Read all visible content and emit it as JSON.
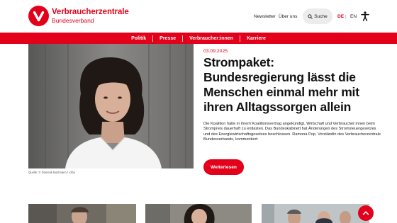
{
  "brand": {
    "title": "Verbraucherzentrale",
    "subtitle": "Bundesverband"
  },
  "utility_nav": {
    "newsletter": "Newsletter",
    "about": "Über uns",
    "search": "Suche",
    "lang_de": "DE",
    "lang_separator": "|",
    "lang_en": "EN"
  },
  "main_nav": [
    {
      "label": "Politik"
    },
    {
      "label": "Presse"
    },
    {
      "label": "Verbraucher:innen"
    },
    {
      "label": "Karriere"
    }
  ],
  "article": {
    "date": "03.09.2025",
    "headline": "Strompaket: Bundesregierung lässt die Menschen einmal mehr mit ihren Alltagssorgen allein",
    "teaser": "Die Koalition hatte in ihrem Koalitionsvertrag angekündigt, Wirtschaft und Verbraucher:innen beim Strompreis dauerhaft zu entlasten. Das Bundeskabinett hat Änderungen des Stromsteuergesetzes und des Energiewirtschaftsgesetzes beschlossen. Ramona Pop, Vorständin des Verbraucherzentrale Bundesverbands, kommentiert:",
    "read_more": "Weiterlesen",
    "image_caption": "Quelle: © Dominik Butzmann / vzbv"
  },
  "icons": {
    "logo": "verbraucherzentrale-logo-icon",
    "search": "search-icon",
    "accessibility": "accessibility-icon",
    "back_to_top": "arrow-up-icon"
  },
  "colors": {
    "brand_red": "#e2001a",
    "text": "#1a1a1a",
    "search_bg": "#ececec"
  }
}
